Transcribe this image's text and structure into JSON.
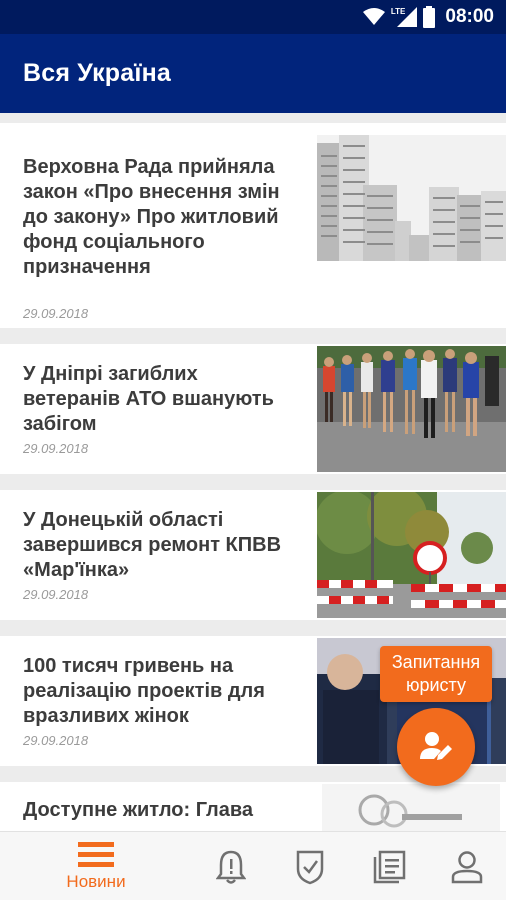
{
  "status_bar": {
    "time": "08:00",
    "network": "LTE"
  },
  "app_bar": {
    "title": "Вся Україна"
  },
  "articles": [
    {
      "headline": "Верховна Рада прийняла закон «Про внесення змін до закону» Про житловий фонд соціального призначення",
      "date": "29.09.2018",
      "image": "residential-buildings"
    },
    {
      "headline": "У Дніпрі загиблих ветеранів АТО вшанують забігом",
      "date": "29.09.2018",
      "image": "runners-race"
    },
    {
      "headline": "У Донецькій області завершився ремонт КПВВ «Мар'їнка»",
      "date": "29.09.2018",
      "image": "checkpoint-barrier"
    },
    {
      "headline": "100 тисяч гривень на реалізацію проектів для вразливих жінок",
      "date": "29.09.2018",
      "image": "conference-people"
    },
    {
      "headline": "Доступне житло: Глава",
      "date": "",
      "image": "keys"
    }
  ],
  "fab": {
    "label": "Запитання юристу",
    "icon": "lawyer-edit-icon"
  },
  "bottom_nav": [
    {
      "label": "Новини",
      "icon": "news-menu-icon",
      "active": true
    },
    {
      "label": "",
      "icon": "bell-alert-icon",
      "active": false
    },
    {
      "label": "",
      "icon": "shield-check-icon",
      "active": false
    },
    {
      "label": "",
      "icon": "documents-icon",
      "active": false
    },
    {
      "label": "",
      "icon": "profile-icon",
      "active": false
    }
  ],
  "colors": {
    "status_bar": "#001a5e",
    "app_bar": "#01247c",
    "accent": "#f26b1d",
    "nav_inactive": "#707070"
  }
}
